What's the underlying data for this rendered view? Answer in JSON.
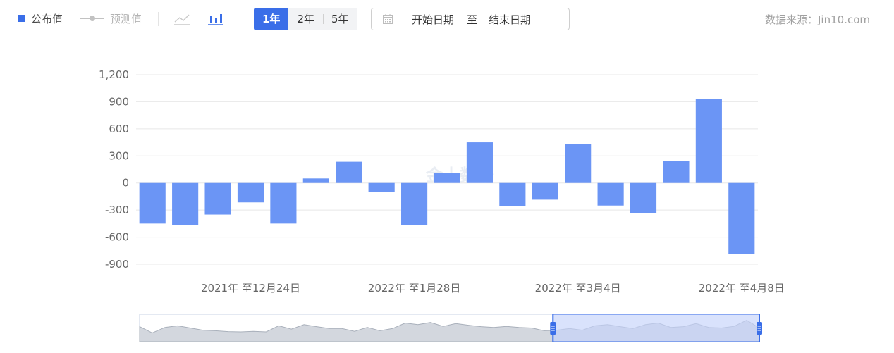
{
  "toolbar": {
    "legend_published": "公布值",
    "legend_forecast": "预测值",
    "periods": [
      "1年",
      "2年",
      "5年"
    ],
    "active_period": "1年",
    "date_start": "开始日期",
    "date_to": "至",
    "date_end": "结束日期",
    "source": "数据来源：Jin10.com"
  },
  "colors": {
    "bar": "#6b95f5",
    "accent": "#3a6ee8",
    "grid": "#e8e8e8",
    "tick_text": "#666666",
    "slider_fill": "#c4d3fb",
    "slider_border": "#3a6ee8",
    "mini_area": "#d3d7de"
  },
  "watermark": "金十数据",
  "chart_data": {
    "type": "bar",
    "ylim": [
      -900,
      1200
    ],
    "yticks": [
      1200,
      900,
      600,
      300,
      0,
      -300,
      -600,
      -900
    ],
    "ytick_labels": [
      "1,200",
      "900",
      "600",
      "300",
      "0",
      "-300",
      "-600",
      "-900"
    ],
    "xtick_labels": [
      "2021年 至12月24日",
      "2022年 至1月28日",
      "2022年 至3月4日",
      "2022年 至4月8日"
    ],
    "xtick_positions": [
      3,
      8,
      13,
      18
    ],
    "values": [
      -450,
      -465,
      -350,
      -215,
      -450,
      50,
      235,
      -100,
      -470,
      110,
      450,
      -255,
      -185,
      430,
      -250,
      -335,
      240,
      930,
      -790
    ],
    "grid": true,
    "legend": "top-left",
    "overview": {
      "values": [
        55,
        32,
        52,
        58,
        50,
        42,
        40,
        37,
        36,
        38,
        36,
        58,
        46,
        62,
        55,
        48,
        48,
        38,
        52,
        40,
        48,
        68,
        62,
        70,
        56,
        66,
        60,
        55,
        52,
        56,
        52,
        50,
        40,
        42,
        48,
        42,
        58,
        62,
        55,
        48,
        62,
        68,
        52,
        55,
        66,
        52,
        50,
        56,
        78,
        50
      ],
      "selection": [
        0.667,
        1.0
      ]
    }
  }
}
